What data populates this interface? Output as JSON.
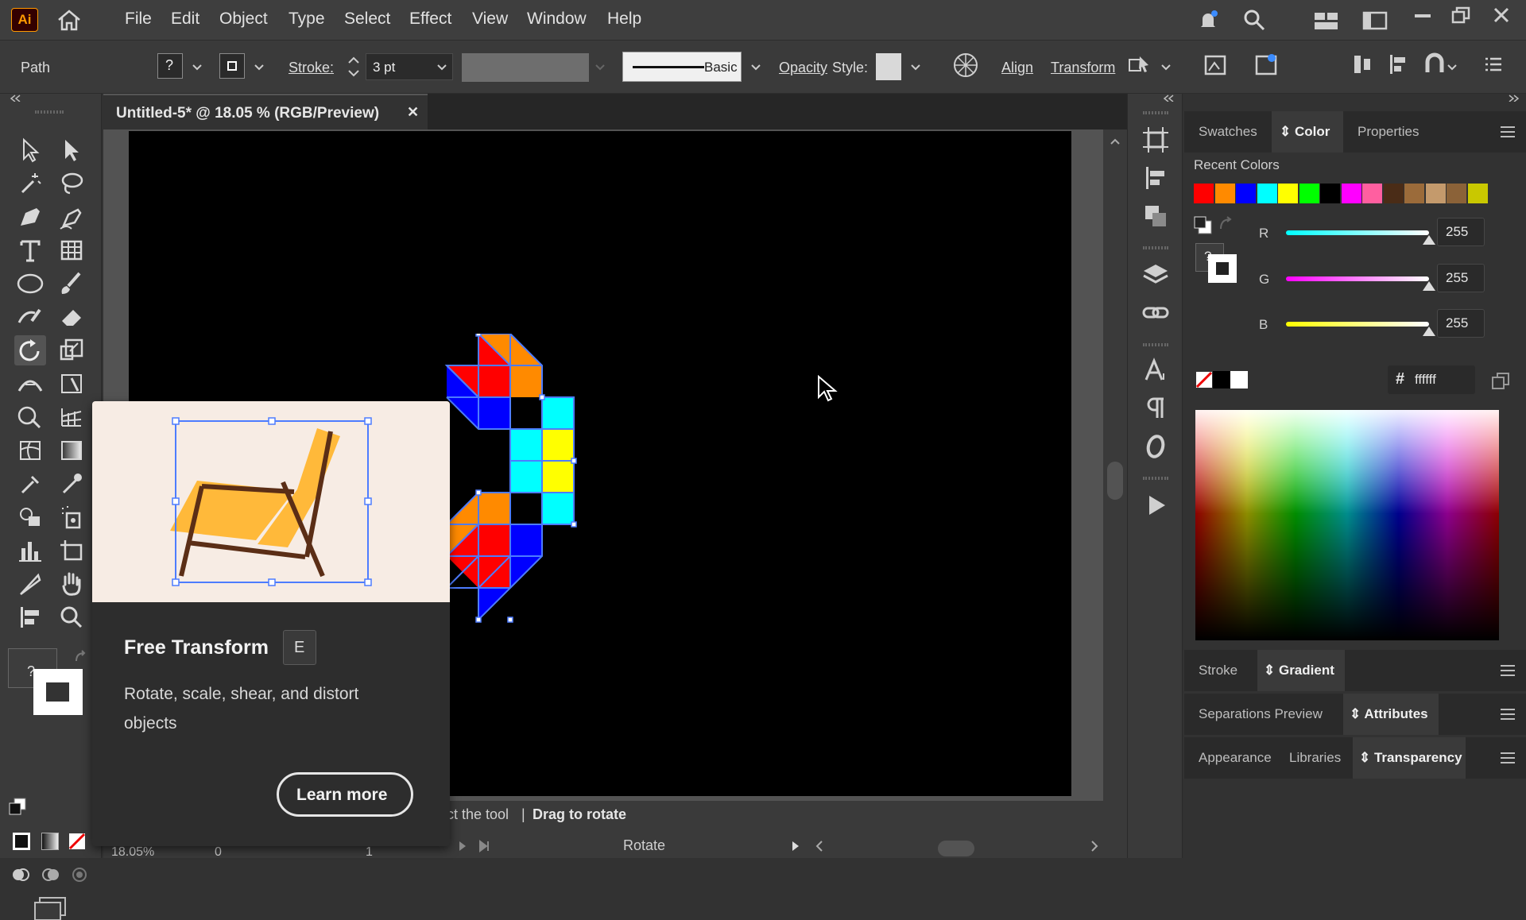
{
  "app": {
    "logo": "Ai"
  },
  "menu": [
    "File",
    "Edit",
    "Object",
    "Type",
    "Select",
    "Effect",
    "View",
    "Window",
    "Help"
  ],
  "control_bar": {
    "selection_label": "Path",
    "stroke_label": "Stroke:",
    "stroke_value": "3 pt",
    "brush_label": "Basic",
    "opacity_label": "Opacity",
    "style_label": "Style:",
    "align_label": "Align",
    "transform_label": "Transform"
  },
  "document_tab": {
    "title": "Untitled-5* @ 18.05 % (RGB/Preview)",
    "close": "✕"
  },
  "tooltip": {
    "title": "Free Transform",
    "shortcut": "E",
    "description_line1": "Rotate, scale, shear, and distort",
    "description_line2": "objects",
    "button": "Learn more"
  },
  "status_bar": {
    "hint_left": "ct the tool",
    "separator": "|",
    "hint_right": "Drag to rotate",
    "zoom": "18.05%",
    "rotation": "0",
    "artboard_number": "1",
    "tool_name": "Rotate"
  },
  "panel_group1": {
    "tabs": [
      "Swatches",
      "Color",
      "Properties"
    ],
    "active": "Color",
    "recent_colors_label": "Recent Colors",
    "recent_colors": [
      "#ff0000",
      "#ff8a00",
      "#0000ff",
      "#00ffff",
      "#ffff00",
      "#00ff00",
      "#000000",
      "#ff00ff",
      "#ff5fa0",
      "#4a2c17",
      "#9b6b3a",
      "#c49a6c",
      "#8b6238",
      "#c9c800"
    ],
    "r_label": "R",
    "r_value": "255",
    "g_label": "G",
    "g_value": "255",
    "b_label": "B",
    "b_value": "255",
    "hex_symbol": "#",
    "hex_value": "ffffff",
    "r_level": 1.0,
    "g_level": 1.0,
    "b_level": 1.0
  },
  "panel_group2": {
    "tabs": [
      "Stroke",
      "Gradient"
    ],
    "active": "Gradient"
  },
  "panel_group3": {
    "tabs": [
      "Separations Preview",
      "Attributes"
    ],
    "active": "Attributes"
  },
  "panel_group4": {
    "tabs": [
      "Appearance",
      "Libraries",
      "Transparency"
    ],
    "active": "Transparency"
  },
  "colors": {
    "accent_selection": "#4d7cff",
    "artwork": [
      "#ff0000",
      "#ff8a00",
      "#0000ff",
      "#00ffff",
      "#ffff00"
    ]
  }
}
